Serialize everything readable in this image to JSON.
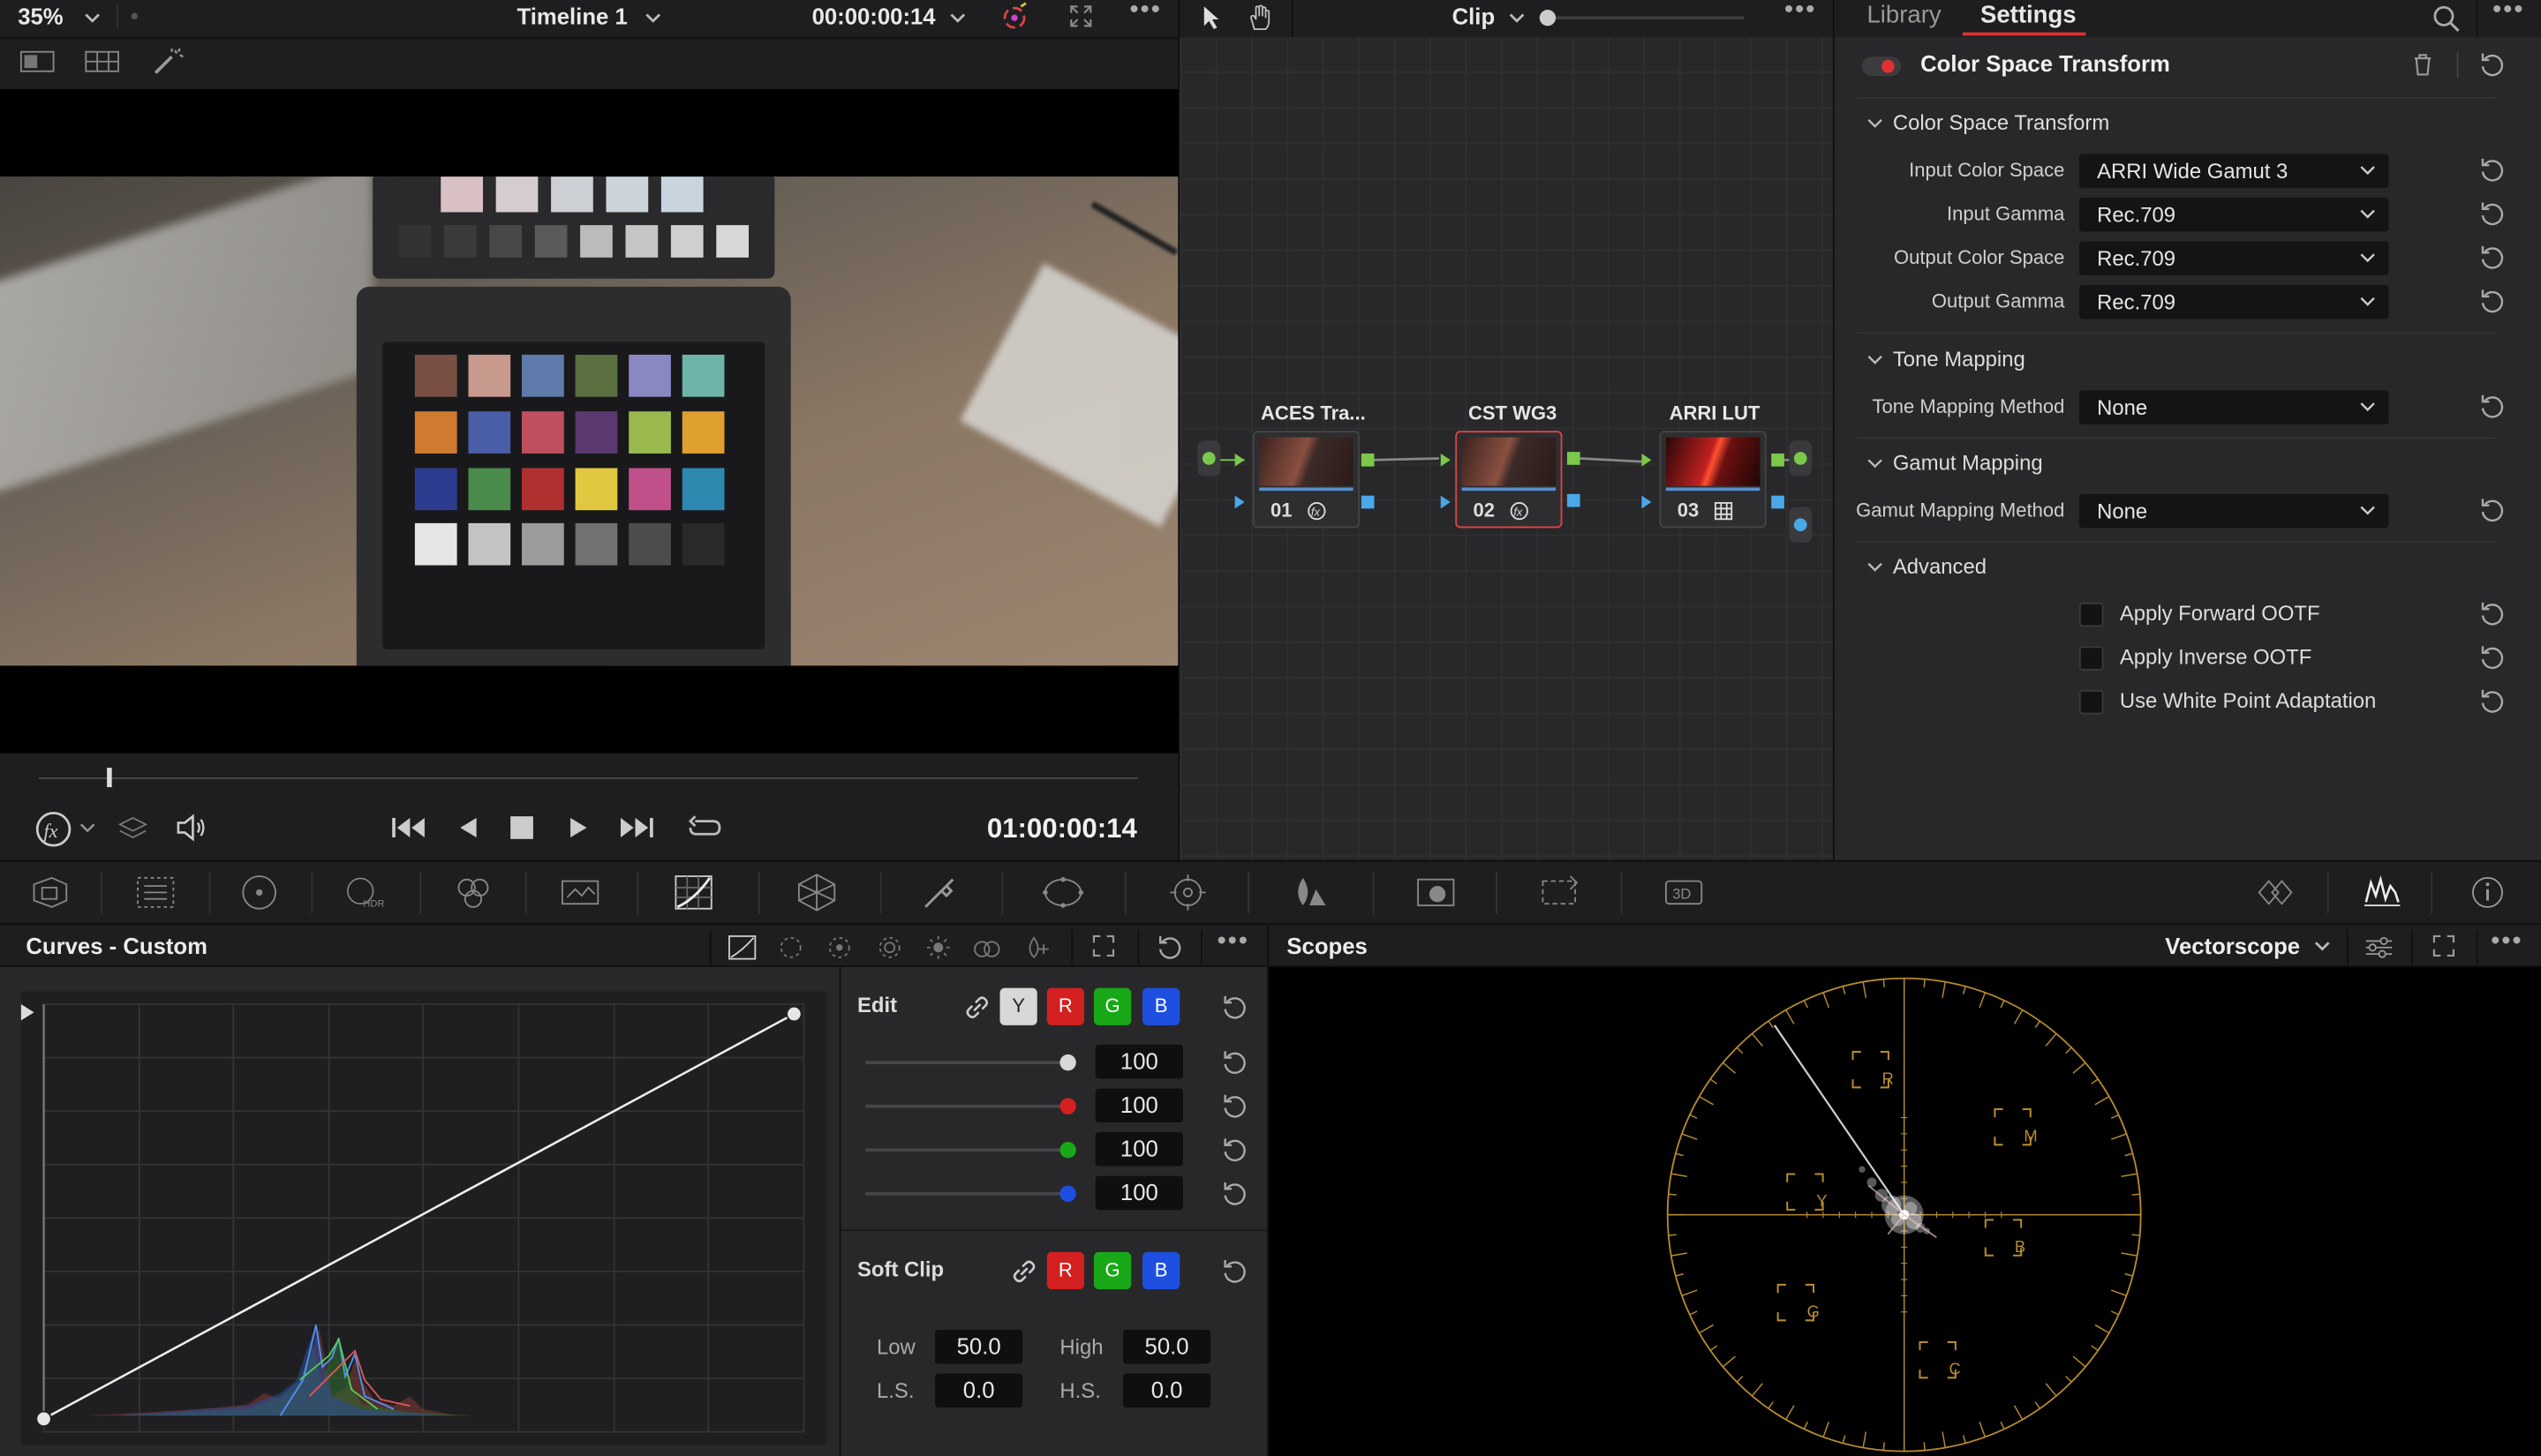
{
  "viewer": {
    "zoom": "35%",
    "timeline_name": "Timeline 1",
    "timecode_top": "00:00:00:14",
    "timecode_main": "01:00:00:14",
    "scrub_position": 0.065
  },
  "node_editor": {
    "mode_label": "Clip",
    "nodes": [
      {
        "label": "ACES Tra...",
        "number": "01"
      },
      {
        "label": "CST WG3",
        "number": "02"
      },
      {
        "label": "ARRI LUT",
        "number": "03"
      }
    ]
  },
  "inspector": {
    "tabs": [
      "Library",
      "Settings"
    ],
    "active_tab": "Settings",
    "effect_title": "Color Space Transform",
    "sections": {
      "cst": "Color Space Transform",
      "tone": "Tone Mapping",
      "gamut": "Gamut Mapping",
      "advanced": "Advanced"
    },
    "fields": {
      "input_color_space": {
        "label": "Input Color Space",
        "value": "ARRI Wide Gamut 3"
      },
      "input_gamma": {
        "label": "Input Gamma",
        "value": "Rec.709"
      },
      "output_color_space": {
        "label": "Output Color Space",
        "value": "Rec.709"
      },
      "output_gamma": {
        "label": "Output Gamma",
        "value": "Rec.709"
      },
      "tone_mapping_method": {
        "label": "Tone Mapping Method",
        "value": "None"
      },
      "gamut_mapping_method": {
        "label": "Gamut Mapping Method",
        "value": "None"
      }
    },
    "checkboxes": [
      {
        "label": "Apply Forward OOTF",
        "checked": false
      },
      {
        "label": "Apply Inverse OOTF",
        "checked": false
      },
      {
        "label": "Use White Point Adaptation",
        "checked": false
      }
    ]
  },
  "curves": {
    "title": "Curves - Custom",
    "edit_label": "Edit",
    "channels": [
      "Y",
      "R",
      "G",
      "B"
    ],
    "slider_values": [
      "100",
      "100",
      "100",
      "100"
    ],
    "soft_clip_label": "Soft Clip",
    "soft_clip_channels": [
      "R",
      "G",
      "B"
    ],
    "low_label": "Low",
    "low_value": "50.0",
    "high_label": "High",
    "high_value": "50.0",
    "ls_label": "L.S.",
    "ls_value": "0.0",
    "hs_label": "H.S.",
    "hs_value": "0.0"
  },
  "scopes": {
    "title": "Scopes",
    "scope_type": "Vectorscope",
    "targets": [
      "R",
      "M",
      "B",
      "C",
      "G",
      "Y"
    ]
  },
  "colors": {
    "accent_red": "#e03030",
    "node_highlight": "#e04545",
    "scope_graticule": "#b58a2e",
    "channel_red": "#d42020",
    "channel_green": "#18a818",
    "channel_blue": "#1f4fe0"
  }
}
